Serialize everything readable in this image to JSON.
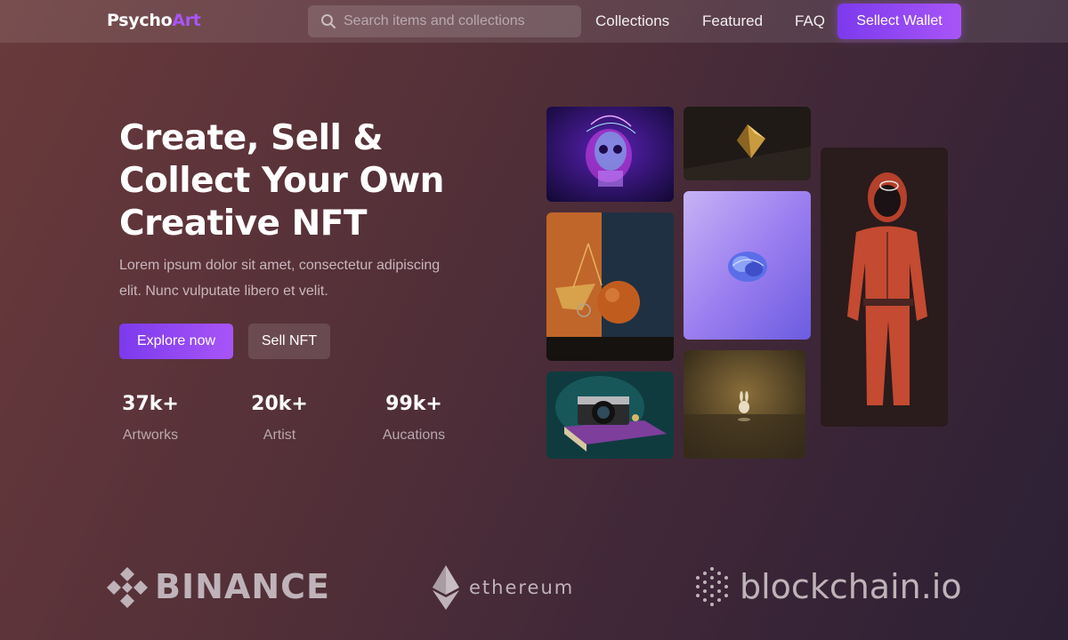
{
  "nav": {
    "logo_main": "Psycho",
    "logo_accent": "Art",
    "search_placeholder": "Search items and collections",
    "links": [
      "Collections",
      "Featured",
      "FAQ"
    ],
    "wallet_button": "Sellect Wallet"
  },
  "hero": {
    "title_lines": [
      "Create, Sell &",
      "Collect Your Own",
      "Creative NFT"
    ],
    "description": "Lorem ipsum dolor sit amet, consectetur adipiscing elit. Nunc vulputate libero et velit.",
    "primary_button": "Explore now",
    "secondary_button": "Sell NFT"
  },
  "stats": [
    {
      "value": "37k+",
      "label": "Artworks"
    },
    {
      "value": "20k+",
      "label": "Artist"
    },
    {
      "value": "99k+",
      "label": "Aucations"
    }
  ],
  "gallery": [
    {
      "subject": "holographic-skull-art"
    },
    {
      "subject": "golden-diamond-art"
    },
    {
      "subject": "abstract-sphere-art"
    },
    {
      "subject": "brain-render-art"
    },
    {
      "subject": "red-jumpsuit-figure-art"
    },
    {
      "subject": "camera-on-book-art"
    },
    {
      "subject": "bunny-figurine-art"
    }
  ],
  "partners": [
    {
      "name": "BINANCE",
      "icon": "binance-logo-icon"
    },
    {
      "name": "ethereum",
      "icon": "ethereum-logo-icon"
    },
    {
      "name": "blockchain.io",
      "icon": "blockchain-logo-icon"
    }
  ],
  "colors": {
    "accent": "#a855f7",
    "accent_dark": "#7c3aed",
    "background_start": "#6a3a3b",
    "background_end": "#2c2035"
  }
}
